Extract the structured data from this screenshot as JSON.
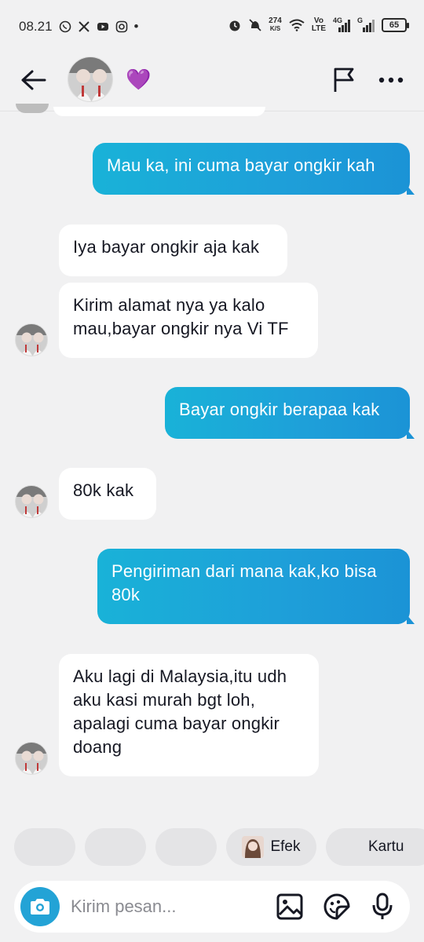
{
  "status_bar": {
    "time": "08.21",
    "net_speed_value": "274",
    "net_speed_unit": "K/S",
    "network_label_top": "Vo",
    "network_label_bottom": "LTE",
    "signal_label": "4G",
    "signal_label_2": "G",
    "battery": "65",
    "dot": "•"
  },
  "header": {
    "heart": "💜"
  },
  "messages": [
    {
      "id": "m1",
      "side": "out",
      "text": "Mau ka, ini cuma bayar ongkir kah"
    },
    {
      "id": "m2",
      "side": "in",
      "text": "Iya bayar ongkir aja kak"
    },
    {
      "id": "m3",
      "side": "in",
      "text": "Kirim alamat nya ya kalo\nmau,bayar ongkir nya Vi TF"
    },
    {
      "id": "m4",
      "side": "out",
      "text": "Bayar ongkir berapaa kak"
    },
    {
      "id": "m5",
      "side": "in",
      "text": "80k kak"
    },
    {
      "id": "m6",
      "side": "out",
      "text": "Pengiriman dari mana kak,ko bisa\n80k"
    },
    {
      "id": "m7",
      "side": "in",
      "text": "Aku lagi di Malaysia,itu udh\naku kasi murah bgt loh,\napalagi cuma bayar ongkir\ndoang"
    }
  ],
  "chips": {
    "efek_label": "Efek",
    "kartu_label": "Kartu"
  },
  "input": {
    "placeholder": "Kirim pesan..."
  },
  "colors": {
    "accent": "#1e9fd9",
    "outgoing_bubble": "#1e9fd9",
    "incoming_bubble": "#ffffff",
    "background": "#f1f1f2"
  }
}
